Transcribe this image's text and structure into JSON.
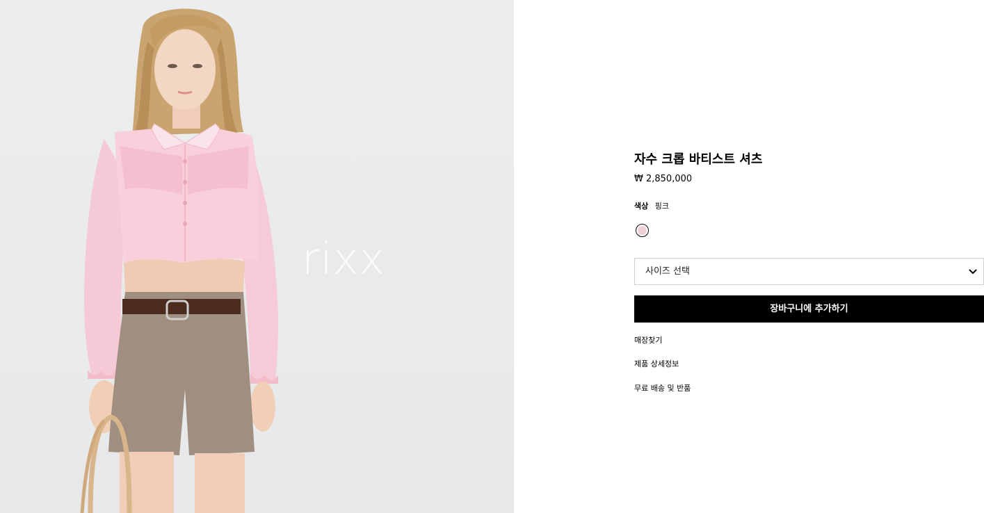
{
  "image": {
    "watermark": "rixx"
  },
  "product": {
    "title": "자수 크롭 바티스트 셔츠",
    "price": "₩ 2,850,000",
    "color_label": "색상",
    "color_value": "핑크",
    "swatch_color": "#efd0d6",
    "size_placeholder": "사이즈 선택",
    "add_to_cart": "장바구니에 추가하기"
  },
  "links": {
    "store_finder": "매장찾기",
    "details": "제품 상세정보",
    "shipping": "무료 배송 및 반품"
  }
}
